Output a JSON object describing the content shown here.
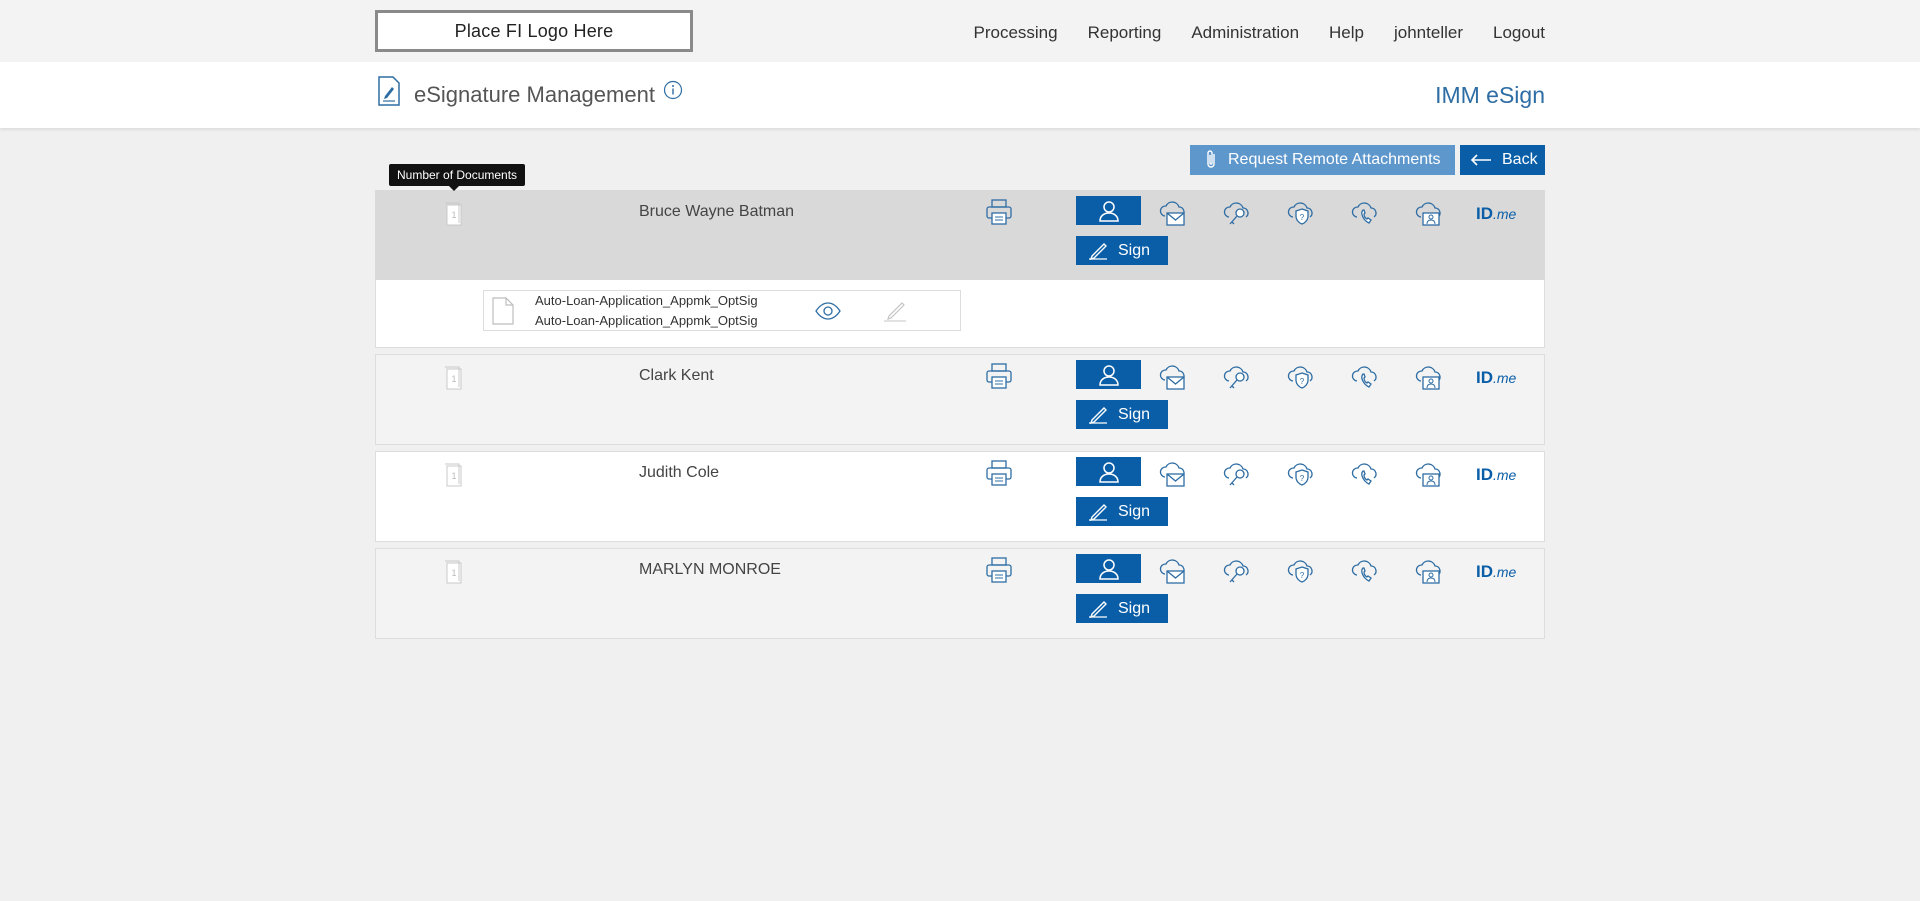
{
  "logo_text": "Place FI Logo Here",
  "nav": {
    "processing": "Processing",
    "reporting": "Reporting",
    "administration": "Administration",
    "help": "Help",
    "user": "johnteller",
    "logout": "Logout"
  },
  "header": {
    "title": "eSignature Management",
    "app_name": "IMM eSign"
  },
  "actions": {
    "request_attachments": "Request Remote Attachments",
    "back": "Back"
  },
  "tooltip": "Number of Documents",
  "signers": [
    {
      "name": "Bruce Wayne Batman",
      "doc_count": "1",
      "sign_label": "Sign",
      "idme": "ID",
      "idme_suffix": ".me"
    },
    {
      "name": "Clark Kent",
      "doc_count": "1",
      "sign_label": "Sign",
      "idme": "ID",
      "idme_suffix": ".me"
    },
    {
      "name": "Judith Cole",
      "doc_count": "1",
      "sign_label": "Sign",
      "idme": "ID",
      "idme_suffix": ".me"
    },
    {
      "name": "MARLYN MONROE",
      "doc_count": "1",
      "sign_label": "Sign",
      "idme": "ID",
      "idme_suffix": ".me"
    }
  ],
  "expanded_docs": {
    "line1": "Auto-Loan-Application_Appmk_OptSig",
    "line2": "Auto-Loan-Application_Appmk_OptSig"
  },
  "colors": {
    "primary": "#0a5ea8",
    "secondary_button": "#5e97cc",
    "app_name": "#2e6da4"
  }
}
